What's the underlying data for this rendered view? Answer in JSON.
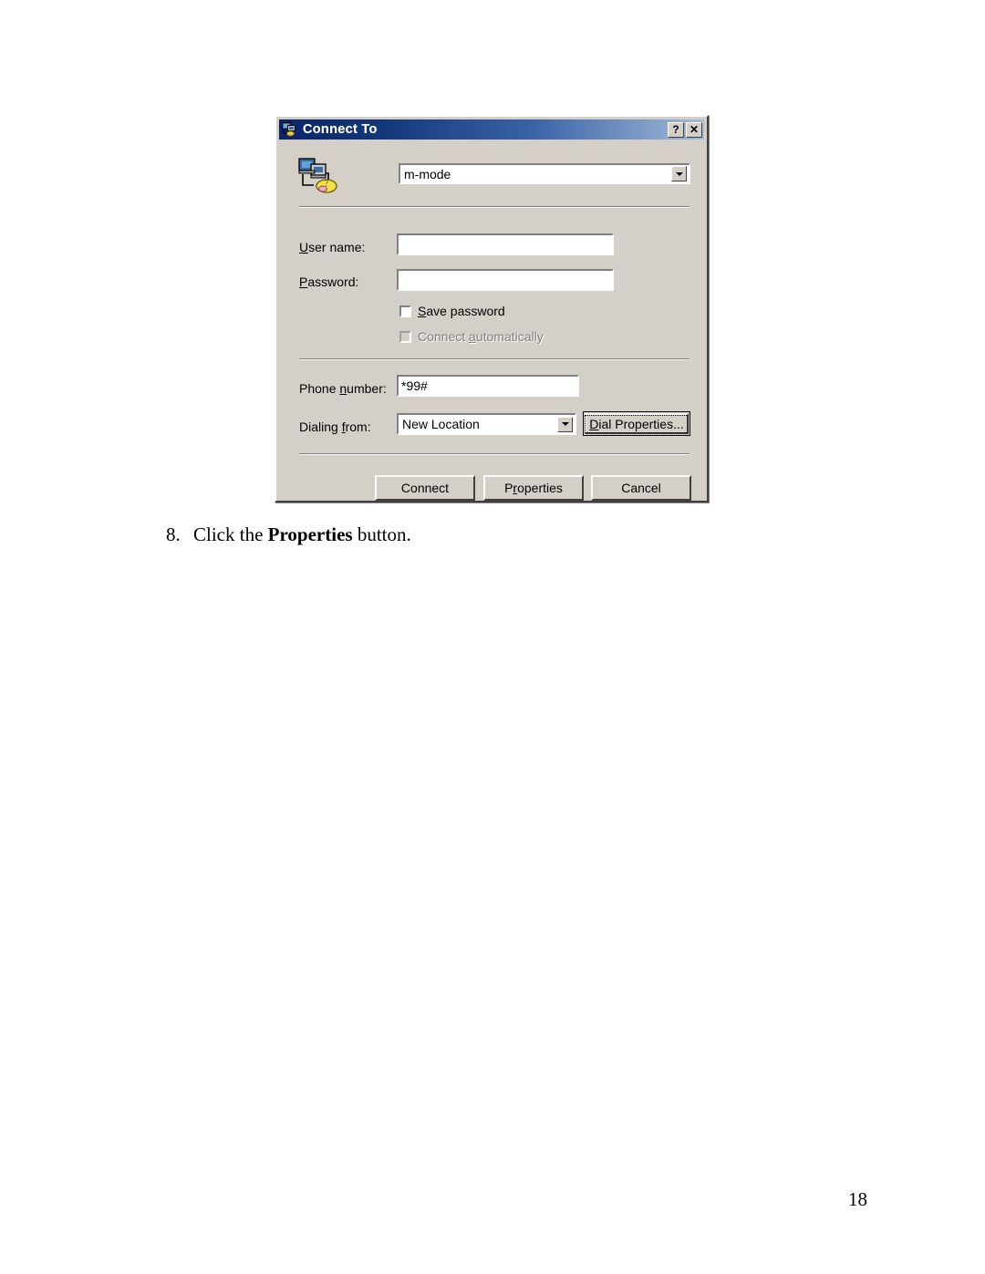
{
  "document": {
    "step_number": "8.",
    "step_text_before": "Click the ",
    "step_text_bold": "Properties",
    "step_text_after": " button.",
    "page_number": "18"
  },
  "dialog": {
    "title": "Connect To",
    "title_icon": "connect-computers-icon",
    "titlebar_buttons": {
      "help_label": "?",
      "close_label": "✕"
    },
    "connection_icon": "dialup-connection-icon",
    "connection": {
      "value": "m-mode",
      "options": [
        "m-mode"
      ]
    },
    "fields": {
      "user_name_label": "User name:",
      "user_name_accel": "U",
      "user_name_value": "",
      "password_label": "Password:",
      "password_accel": "P",
      "password_value": "",
      "phone_number_label": "Phone number:",
      "phone_number_accel": "n",
      "phone_number_value": "*99#",
      "dialing_from_label": "Dialing from:",
      "dialing_from_accel": "f",
      "dialing_from_value": "New Location",
      "dialing_from_options": [
        "New Location"
      ]
    },
    "checkboxes": [
      {
        "label": "Save password",
        "accel": "S",
        "checked": false,
        "disabled": false
      },
      {
        "label": "Connect automatically",
        "accel": "a",
        "checked": false,
        "disabled": true
      }
    ],
    "dial_properties_button": {
      "label_before": "D",
      "label_after": "ial Properties...",
      "focused": true
    },
    "buttons": [
      {
        "label_before": "",
        "label_accel": "",
        "label_after": "Connect"
      },
      {
        "label_before": "P",
        "label_accel": "r",
        "label_after": "operties"
      },
      {
        "label_before": "",
        "label_accel": "",
        "label_after": "Cancel"
      }
    ],
    "button_labels": {
      "connect": "Connect",
      "properties": "Properties",
      "cancel": "Cancel"
    }
  },
  "colors": {
    "dialog_face": "#d4d0c8",
    "titlebar_start": "#0a246a",
    "titlebar_end": "#a6bcd9",
    "disabled_text": "#808080",
    "field_bg": "#ffffff"
  }
}
